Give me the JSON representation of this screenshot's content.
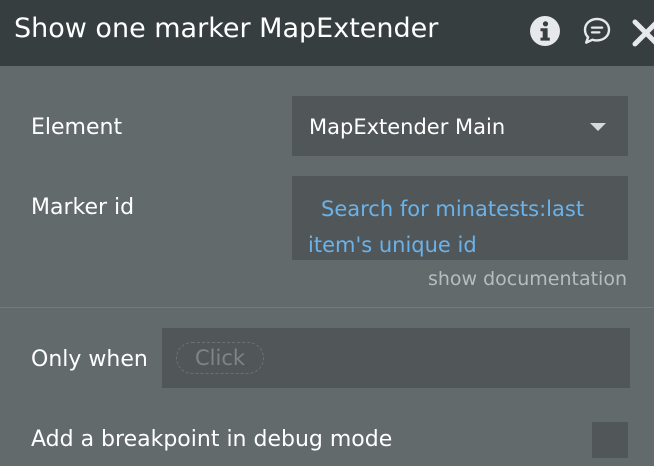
{
  "header": {
    "title": "Show one marker MapExtender",
    "icons": [
      "info-icon",
      "comment-icon",
      "close-icon"
    ]
  },
  "element_field": {
    "label": "Element",
    "value": "MapExtender Main"
  },
  "marker_id_field": {
    "label": "Marker id",
    "expression": "Search for minatests:last item's unique id"
  },
  "documentation_link": "show documentation",
  "only_when_field": {
    "label": "Only when",
    "placeholder": "Click"
  },
  "breakpoint": {
    "label": "Add a breakpoint in debug mode",
    "checked": false
  },
  "colors": {
    "header_bg": "#373e40",
    "panel_bg": "#626a6c",
    "field_bg": "#515759",
    "expression_text": "#6ab2ea"
  }
}
